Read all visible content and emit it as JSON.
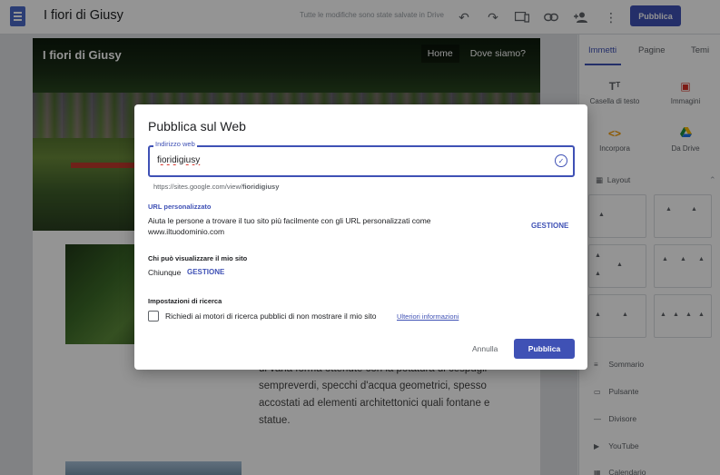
{
  "app": {
    "site_title": "I fiori di Giusy",
    "save_status": "Tutte le modifiche sono state salvate in Drive",
    "publish_label": "Pubblica",
    "icons": [
      "undo-icon",
      "redo-icon",
      "preview-icon",
      "link-icon",
      "share-icon",
      "more-icon"
    ]
  },
  "page": {
    "hero_title": "I fiori di Giusy",
    "nav": [
      "Home",
      "Dove siamo?"
    ],
    "body_lines": [
      "di varia forma ottenute con la potatura di cespugli",
      "sempreverdi, specchi d'acqua geometrici, spesso",
      "accostati ad elementi architettonici quali fontane e",
      "statue."
    ]
  },
  "panel": {
    "tabs": [
      "Immetti",
      "Pagine",
      "Temi"
    ],
    "inserts": [
      {
        "label": "Casella di testo",
        "icon": "text-box-icon"
      },
      {
        "label": "Immagini",
        "icon": "image-icon"
      },
      {
        "label": "Incorpora",
        "icon": "embed-icon"
      },
      {
        "label": "Da Drive",
        "icon": "drive-icon"
      }
    ],
    "layout_label": "Layout",
    "components": [
      "Sommario",
      "Pulsante",
      "Divisore",
      "YouTube",
      "Calendario"
    ]
  },
  "dialog": {
    "title": "Pubblica sul Web",
    "field_label": "Indirizzo web",
    "field_value": "fioridigiusy",
    "url_prefix": "https://sites.google.com/view/",
    "url_suffix": "fioridigiusy",
    "custom_url_title": "URL personalizzato",
    "custom_url_text_1": "Aiuta le persone a trovare il tuo sito più facilmente con gli URL personalizzati come",
    "custom_url_text_2": "www.iltuodominio.com",
    "custom_url_action": "GESTIONE",
    "visibility_title": "Chi può visualizzare il mio sito",
    "visibility_value": "Chiunque",
    "visibility_action": "GESTIONE",
    "search_title": "Impostazioni di ricerca",
    "search_checkbox_label": "Richiedi ai motori di ricerca pubblici di non mostrare il mio sito",
    "search_more_link": "Ulteriori informazioni",
    "cancel_label": "Annulla",
    "publish_label": "Pubblica"
  },
  "colors": {
    "accent": "#3f51b5",
    "overlay": "rgba(0,0,0,0.42)"
  }
}
